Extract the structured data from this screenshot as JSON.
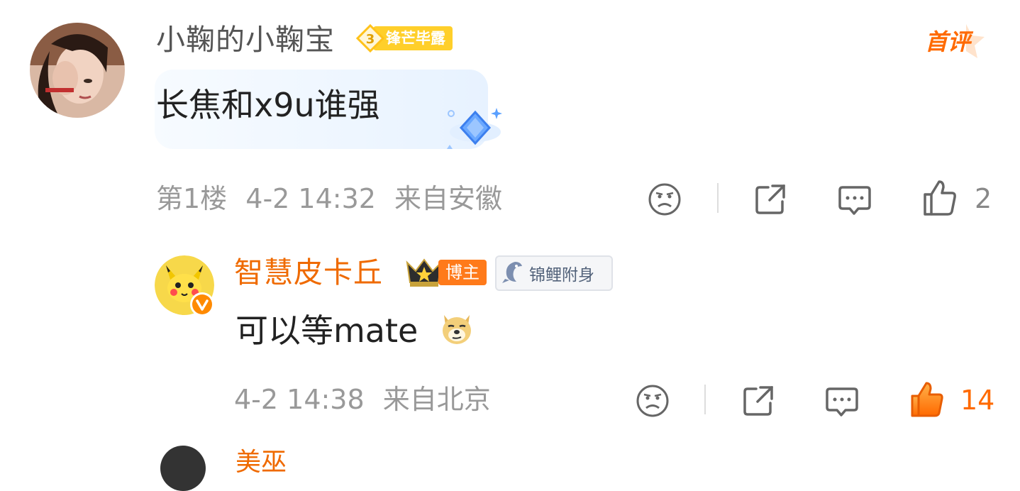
{
  "comment": {
    "author": "小鞠的小鞠宝",
    "level_number": "3",
    "level_title": "锋芒毕露",
    "badge_first": "首评",
    "text": "长焦和x9u谁强",
    "floor": "第1楼",
    "time": "4-2 14:32",
    "location": "来自安徽",
    "like_count": "2"
  },
  "reply": {
    "author": "智慧皮卡丘",
    "role_tag": "博主",
    "fan_badge": "锦鲤附身",
    "text": "可以等mate",
    "time": "4-2 14:38",
    "location": "来自北京",
    "like_count": "14"
  },
  "next": {
    "author": "美巫"
  },
  "colors": {
    "accent_orange": "#ff6a00",
    "name_orange": "#ef6a00",
    "meta_gray": "#999999",
    "level_gold": "#ffcf2a"
  },
  "icons": [
    "dislike-face-icon",
    "share-icon",
    "reply-icon",
    "like-thumb-icon",
    "diamond-icon",
    "crown-icon",
    "koi-icon",
    "doge-emoji-icon",
    "verified-v-icon"
  ]
}
